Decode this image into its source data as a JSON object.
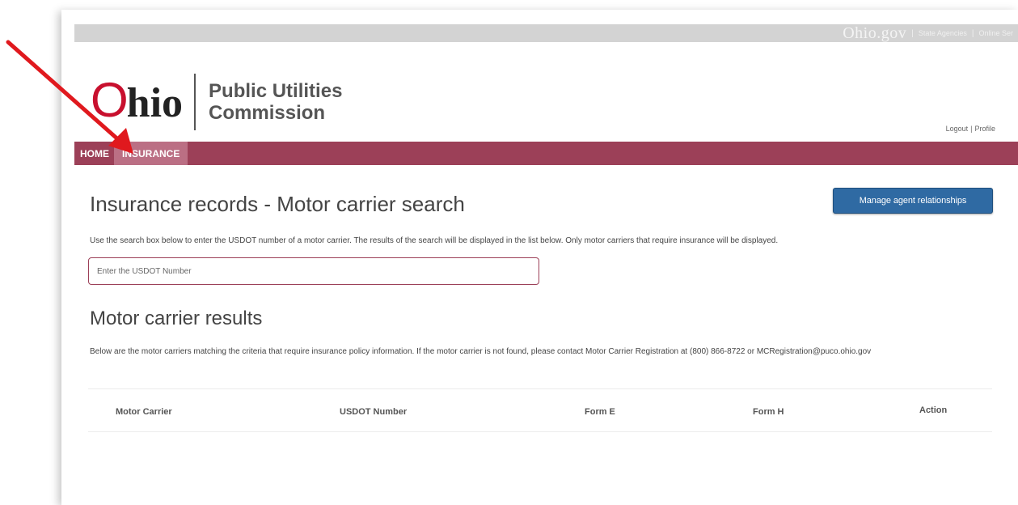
{
  "topbar": {
    "brand": "Ohio.gov",
    "links": [
      "State Agencies",
      "Online Ser"
    ],
    "separator": "|"
  },
  "logo": {
    "wordmark_initial": "O",
    "wordmark_rest": "hio",
    "org_line1": "Public Utilities",
    "org_line2": "Commission"
  },
  "user_links": {
    "logout": "Logout",
    "separator": "|",
    "profile": "Profile"
  },
  "nav": {
    "items": [
      {
        "label": "HOME",
        "active": false
      },
      {
        "label": "INSURANCE",
        "active": true
      }
    ]
  },
  "page": {
    "title": "Insurance records - Motor carrier search",
    "manage_button": "Manage agent relationships",
    "instructions": "Use the search box below to enter the USDOT number of a motor carrier. The results of the search will be displayed in the list below. Only motor carriers that require insurance will be displayed.",
    "search": {
      "placeholder": "Enter the USDOT Number",
      "value": ""
    }
  },
  "results": {
    "title": "Motor carrier results",
    "description": "Below are the motor carriers matching the criteria that require insurance policy information. If the motor carrier is not found, please contact Motor Carrier Registration at (800) 866-8722 or MCRegistration@puco.ohio.gov",
    "columns": [
      "Motor Carrier",
      "USDOT Number",
      "Form E",
      "Form H",
      "Action"
    ],
    "rows": []
  },
  "annotation": {
    "arrow_color": "#e0191e",
    "target": "nav.items.1"
  },
  "colors": {
    "nav_background": "#9c4058",
    "nav_active": "#bb6f84",
    "button_primary": "#2f6aa3",
    "logo_accent": "#c8102e"
  }
}
